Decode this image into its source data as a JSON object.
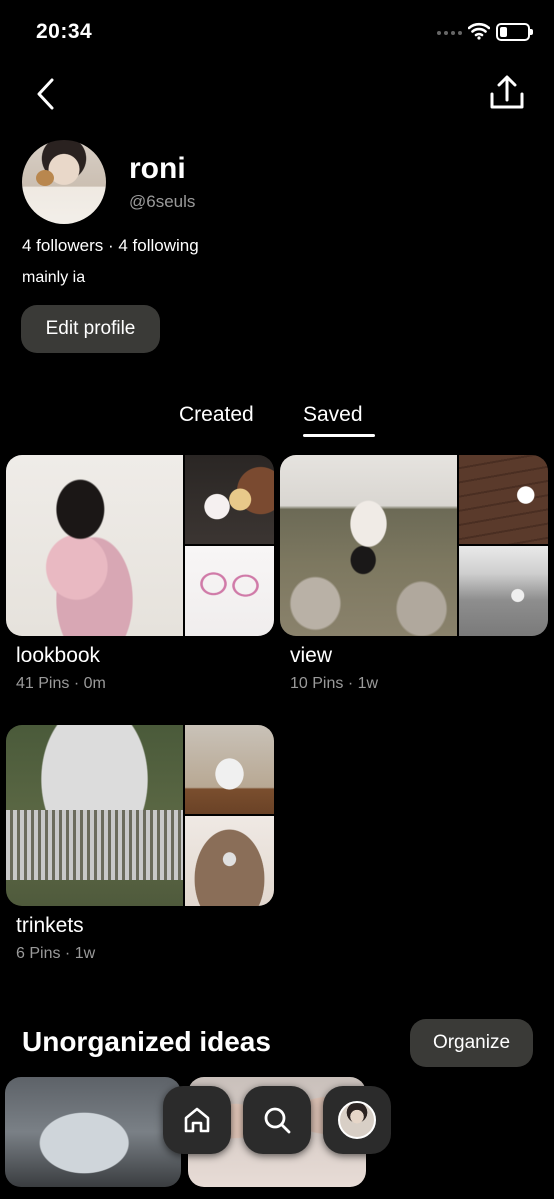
{
  "status_bar": {
    "time": "20:34"
  },
  "profile": {
    "name": "roni",
    "handle": "@6seuls",
    "follow_stats": "4 followers · 4 following",
    "bio": "mainly ia",
    "edit_label": "Edit profile"
  },
  "tabs": [
    {
      "label": "Created",
      "active": false
    },
    {
      "label": "Saved",
      "active": true
    }
  ],
  "boards": [
    {
      "title": "lookbook",
      "meta": "41 Pins · 0m"
    },
    {
      "title": "view",
      "meta": "10 Pins · 1w"
    },
    {
      "title": "trinkets",
      "meta": "6 Pins · 1w"
    }
  ],
  "unorganized": {
    "title": "Unorganized ideas",
    "organize_label": "Organize"
  },
  "nav": {
    "icons": [
      "home-icon",
      "search-icon",
      "profile-avatar"
    ]
  },
  "colors": {
    "background": "#000000",
    "button_bg": "#3a3a37",
    "muted_text": "#9a9a9a"
  }
}
